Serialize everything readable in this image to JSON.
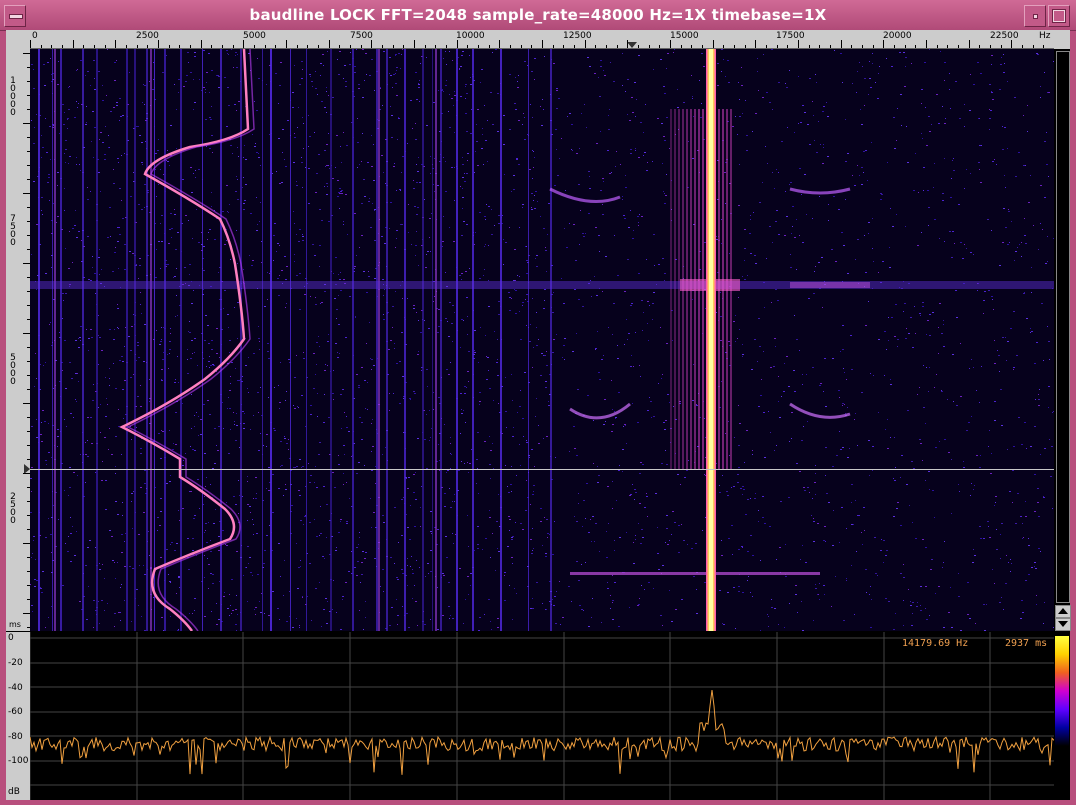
{
  "window": {
    "title": "baudline  LOCK FFT=2048 sample_rate=48000 Hz=1X timebase=1X"
  },
  "freq_axis": {
    "unit": "Hz",
    "ticks": [
      "0",
      "2500",
      "5000",
      "7500",
      "10000",
      "12500",
      "15000",
      "17500",
      "20000",
      "22500"
    ]
  },
  "time_axis": {
    "unit": "ms",
    "ticks": [
      "10000",
      "7500",
      "5000",
      "2500"
    ]
  },
  "spectrum": {
    "db_unit": "dB",
    "db_ticks": [
      "0",
      "-20",
      "-40",
      "-60",
      "-80",
      "-100"
    ],
    "cursor_freq": "14179.69 Hz",
    "cursor_time": "2937 ms"
  },
  "colors": {
    "title_bar": "#b84f7d",
    "trace": "#f0a040",
    "grid": "#444444",
    "tone": "#ffff30"
  },
  "icons": {
    "window_menu": "window-menu-icon",
    "minimize": "minimize-icon",
    "maximize": "maximize-icon",
    "scroll_up": "arrow-up-icon",
    "scroll_down": "arrow-down-icon"
  }
}
